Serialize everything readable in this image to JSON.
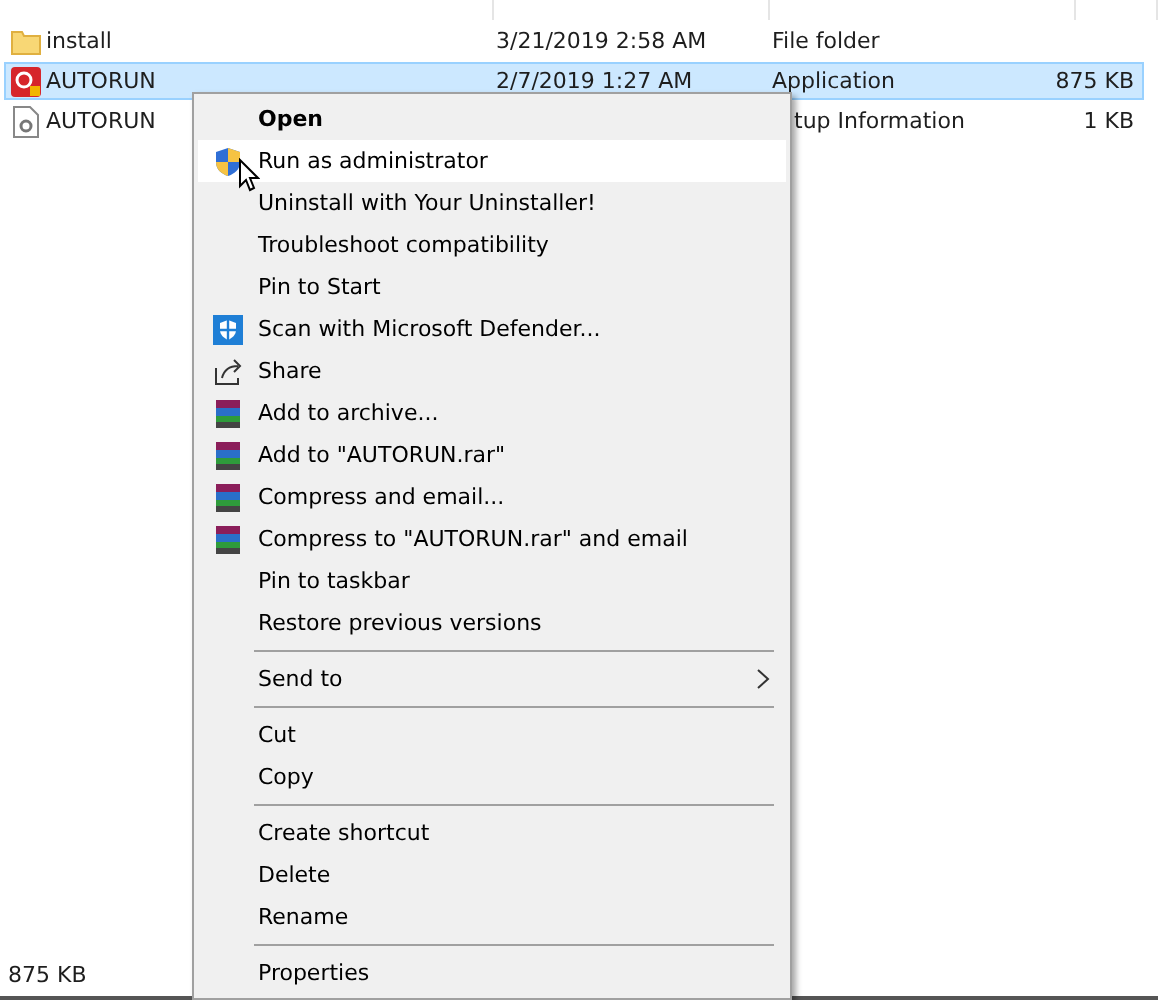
{
  "files": [
    {
      "kind": "folder",
      "name": "install",
      "date": "3/21/2019 2:58 AM",
      "type": "File folder",
      "selected": false
    },
    {
      "kind": "application",
      "name": "AUTORUN",
      "date": "2/7/2019 1:27 AM",
      "type": "Application",
      "size": "875 KB",
      "selected": true
    },
    {
      "kind": "setup",
      "name": "AUTORUN",
      "type": "tup Information",
      "size": "1 KB",
      "selected": false
    }
  ],
  "context_menu": [
    {
      "kind": "plain",
      "label": "Open",
      "bold": true,
      "selected": false
    },
    {
      "kind": "shield",
      "label": "Run as administrator",
      "bold": false,
      "selected": true
    },
    {
      "kind": "plain",
      "label": "Uninstall with Your Uninstaller!",
      "bold": false,
      "selected": false
    },
    {
      "kind": "plain",
      "label": "Troubleshoot compatibility",
      "bold": false,
      "selected": false
    },
    {
      "kind": "plain",
      "label": "Pin to Start",
      "bold": false,
      "selected": false
    },
    {
      "kind": "defender",
      "label": "Scan with Microsoft Defender...",
      "bold": false,
      "selected": false
    },
    {
      "kind": "share",
      "label": "Share",
      "bold": false,
      "selected": false
    },
    {
      "kind": "archive",
      "label": "Add to archive...",
      "bold": false,
      "selected": false
    },
    {
      "kind": "archive",
      "label": "Add to \"AUTORUN.rar\"",
      "bold": false,
      "selected": false
    },
    {
      "kind": "archive",
      "label": "Compress and email...",
      "bold": false,
      "selected": false
    },
    {
      "kind": "archive",
      "label": "Compress to \"AUTORUN.rar\" and email",
      "bold": false,
      "selected": false
    },
    {
      "kind": "plain",
      "label": "Pin to taskbar",
      "bold": false,
      "selected": false
    },
    {
      "kind": "plain",
      "label": "Restore previous versions",
      "bold": false,
      "selected": false
    },
    {
      "kind": "separator"
    },
    {
      "kind": "submenu",
      "label": "Send to",
      "bold": false,
      "selected": false
    },
    {
      "kind": "separator"
    },
    {
      "kind": "plain",
      "label": "Cut",
      "bold": false,
      "selected": false
    },
    {
      "kind": "plain",
      "label": "Copy",
      "bold": false,
      "selected": false
    },
    {
      "kind": "separator"
    },
    {
      "kind": "plain",
      "label": "Create shortcut",
      "bold": false,
      "selected": false
    },
    {
      "kind": "plain",
      "label": "Delete",
      "bold": false,
      "selected": false
    },
    {
      "kind": "plain",
      "label": "Rename",
      "bold": false,
      "selected": false
    },
    {
      "kind": "separator"
    },
    {
      "kind": "plain",
      "label": "Properties",
      "bold": false,
      "selected": false
    }
  ],
  "status_bar": {
    "selection_size": "875 KB"
  }
}
